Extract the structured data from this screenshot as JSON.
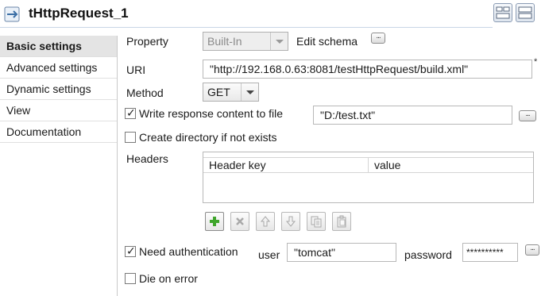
{
  "header": {
    "title": "tHttpRequest_1",
    "component_icon": "http-component-icon",
    "layout_buttons": [
      "tab-layout-icon",
      "split-layout-icon"
    ]
  },
  "sidebar": {
    "items": [
      {
        "label": "Basic settings",
        "active": true
      },
      {
        "label": "Advanced settings",
        "active": false
      },
      {
        "label": "Dynamic settings",
        "active": false
      },
      {
        "label": "View",
        "active": false
      },
      {
        "label": "Documentation",
        "active": false
      }
    ]
  },
  "form": {
    "property": {
      "label": "Property",
      "value": "Built-In",
      "options_visible": [
        "Built-In"
      ]
    },
    "edit_schema": {
      "label": "Edit schema",
      "button": "..."
    },
    "uri": {
      "label": "URI",
      "value": "\"http://192.168.0.63:8081/testHttpRequest/build.xml\"",
      "required_mark": "*"
    },
    "method": {
      "label": "Method",
      "value": "GET"
    },
    "write_response": {
      "label": "Write response content to file",
      "checked": true,
      "value": "\"D:/test.txt\"",
      "button": "..."
    },
    "create_directory": {
      "label": "Create directory if not exists",
      "checked": false
    },
    "headers": {
      "label": "Headers",
      "columns": [
        "Header key",
        "value"
      ],
      "rows": [],
      "toolbar": [
        "add-row-icon",
        "remove-row-icon",
        "move-up-icon",
        "move-down-icon",
        "copy-icon",
        "paste-icon"
      ]
    },
    "need_auth": {
      "label": "Need authentication",
      "checked": true
    },
    "user": {
      "label": "user",
      "value": "\"tomcat\""
    },
    "password": {
      "label": "password",
      "value": "**********",
      "button": "..."
    },
    "die_on_error": {
      "label": "Die on error",
      "checked": false
    }
  },
  "colors": {
    "active_sidebar": "#e4e4e4",
    "add_icon": "#3fa52b",
    "header_line": "#c9d6e6"
  }
}
